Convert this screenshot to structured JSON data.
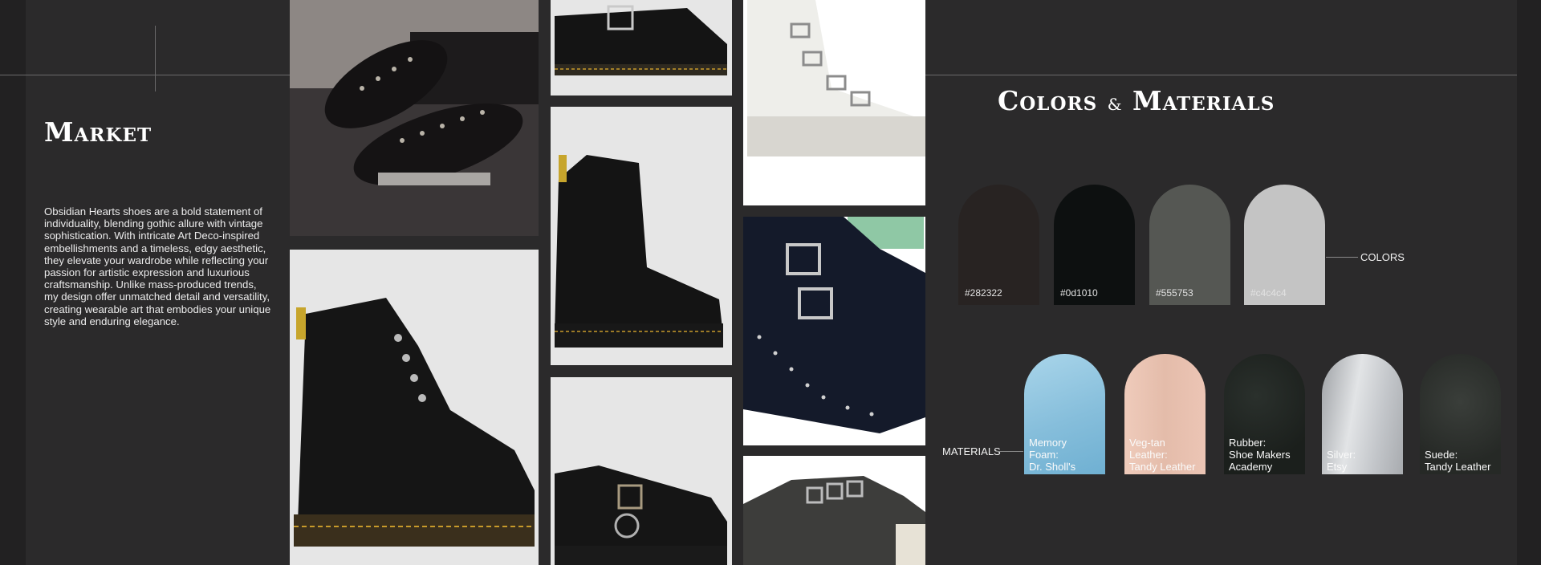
{
  "market": {
    "title": "Market",
    "body": "Obsidian Hearts shoes are a bold statement of individuality, blending gothic allure with vintage sophistication. With intricate Art Deco-inspired embellishments and a timeless, edgy aesthetic, they elevate your wardrobe while reflecting your passion for artistic expression and luxurious craftsmanship. Unlike mass-produced trends, my design offer unmatched detail and versatility, creating wearable art that embodies your unique style and enduring elegance."
  },
  "colors_materials": {
    "title_part1": "Colors",
    "title_amp": "&",
    "title_part2": "Materials",
    "colors_label": "COLORS",
    "materials_label": "MATERIALS",
    "swatches": [
      {
        "hex": "#282322",
        "color": "#282322"
      },
      {
        "hex": "#0d1010",
        "color": "#0d1010"
      },
      {
        "hex": "#555753",
        "color": "#555753"
      },
      {
        "hex": "#c4c4c4",
        "color": "#c4c4c4"
      }
    ],
    "materials": [
      {
        "label": "Memory\nFoam:\nDr. Sholl's",
        "color": "#8fc3dd"
      },
      {
        "label": "Veg-tan\nLeather:\nTandy Leather",
        "color": "#e8c2b2"
      },
      {
        "label": "Rubber:\nShoe Makers\nAcademy",
        "color": "#1f2320"
      },
      {
        "label": "Silver:\nEtsy",
        "color": "#c9cbce"
      },
      {
        "label": "Suede:\nTandy Leather",
        "color": "#2b2e2b"
      }
    ]
  },
  "photos": [
    {
      "name": "studded-oxford-photo"
    },
    {
      "name": "black-combat-boot-zipper-photo"
    },
    {
      "name": "black-buckle-shoe-photo"
    },
    {
      "name": "black-zip-boot-photo"
    },
    {
      "name": "black-buckle-loafer-photo"
    },
    {
      "name": "white-buckle-sneaker-photo"
    },
    {
      "name": "studded-double-buckle-shoe-photo"
    },
    {
      "name": "grey-buckle-sneaker-photo"
    }
  ]
}
